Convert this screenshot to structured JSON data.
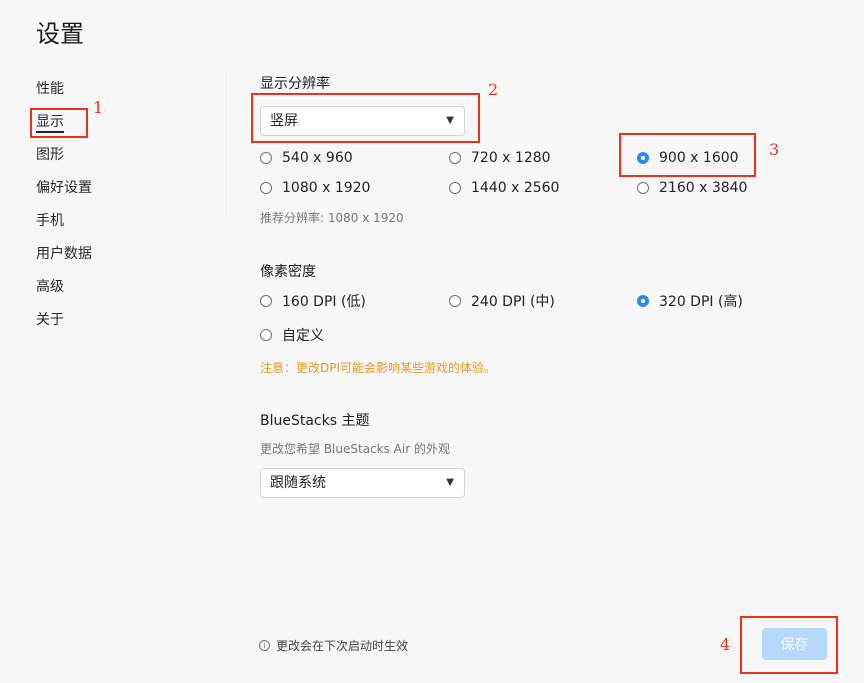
{
  "title": "设置",
  "nav": [
    "性能",
    "显示",
    "图形",
    "偏好设置",
    "手机",
    "用户数据",
    "高级",
    "关于"
  ],
  "display": {
    "resolution_label": "显示分辨率",
    "orientation_value": "竖屏",
    "resolutions": [
      "540 x 960",
      "720 x 1280",
      "900 x 1600",
      "1080 x 1920",
      "1440 x 2560",
      "2160 x 3840"
    ],
    "selected_resolution": "900 x 1600",
    "recommended": "推荐分辨率: 1080 x 1920",
    "density_label": "像素密度",
    "densities": [
      "160 DPI (低)",
      "240 DPI (中)",
      "320 DPI (高)",
      "自定义"
    ],
    "selected_density": "320 DPI (高)",
    "warning": "注意：更改DPI可能会影响某些游戏的体验。",
    "theme_label": "BlueStacks 主题",
    "theme_hint": "更改您希望 BlueStacks Air 的外观",
    "theme_value": "跟随系统"
  },
  "footer": {
    "note_icon": "info-icon",
    "note": "更改会在下次启动时生效",
    "save_label": "保存"
  },
  "annotations": [
    "1",
    "2",
    "3",
    "4"
  ],
  "colors": {
    "accent": "#2f88ef",
    "warning": "#e39a1f",
    "annotation": "#e8321e",
    "save_disabled": "#b6d8fb"
  }
}
